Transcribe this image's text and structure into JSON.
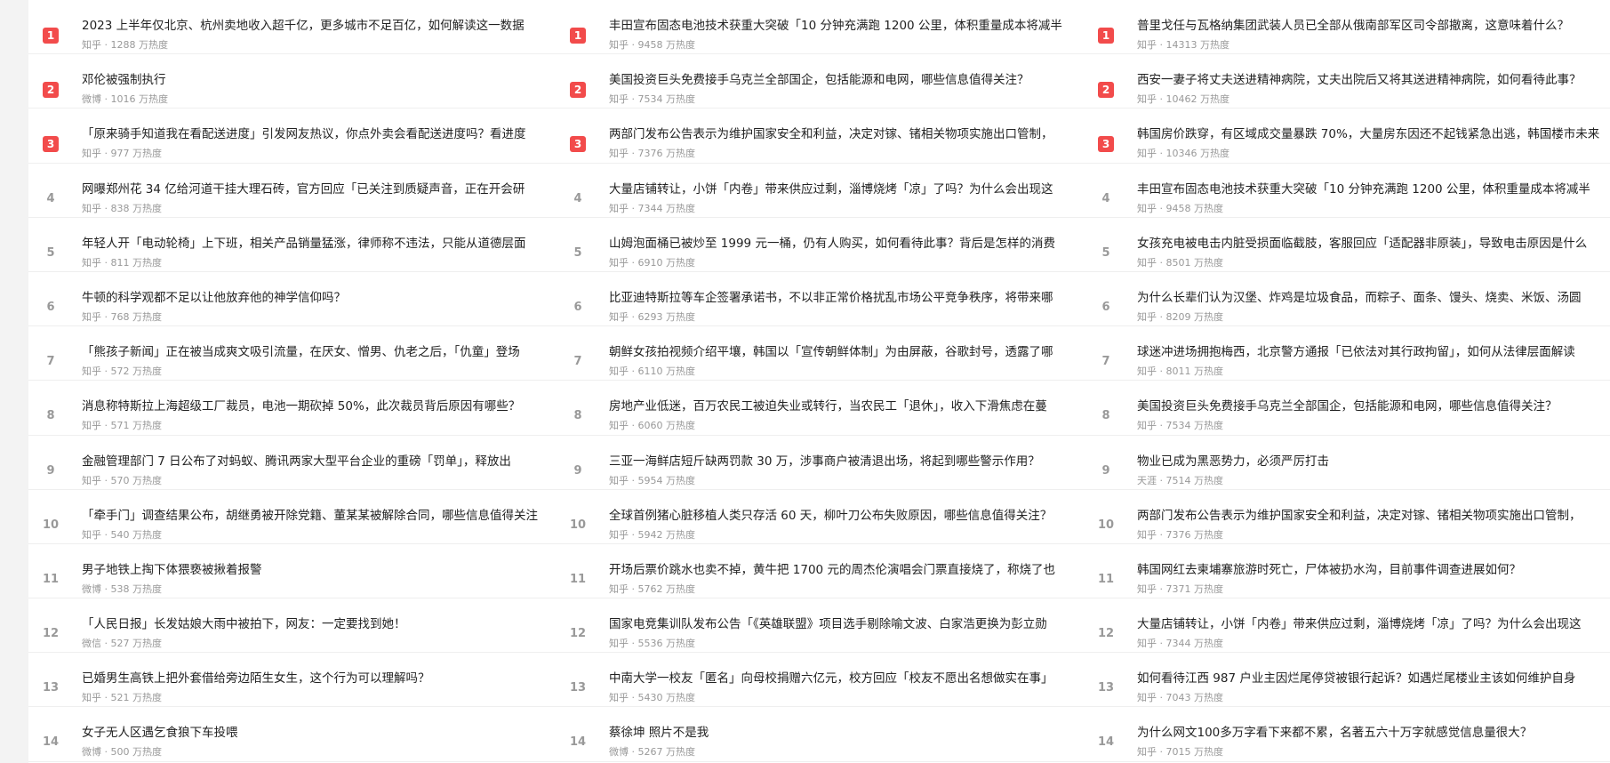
{
  "columns": [
    {
      "items": [
        {
          "rank": "1",
          "title": "2023 上半年仅北京、杭州卖地收入超千亿，更多城市不足百亿，如何解读这一数据",
          "meta": "知乎 · 1288 万热度"
        },
        {
          "rank": "2",
          "title": "邓伦被强制执行",
          "meta": "微博 · 1016 万热度"
        },
        {
          "rank": "3",
          "title": "「原来骑手知道我在看配送进度」引发网友热议，你点外卖会看配送进度吗？看进度",
          "meta": "知乎 · 977 万热度"
        },
        {
          "rank": "4",
          "title": "网曝郑州花 34 亿给河道干挂大理石砖，官方回应「已关注到质疑声音，正在开会研",
          "meta": "知乎 · 838 万热度"
        },
        {
          "rank": "5",
          "title": "年轻人开「电动轮椅」上下班，相关产品销量猛涨，律师称不违法，只能从道德层面",
          "meta": "知乎 · 811 万热度"
        },
        {
          "rank": "6",
          "title": "牛顿的科学观都不足以让他放弃他的神学信仰吗？",
          "meta": "知乎 · 768 万热度"
        },
        {
          "rank": "7",
          "title": "「熊孩子新闻」正在被当成爽文吸引流量，在厌女、憎男、仇老之后，「仇童」登场",
          "meta": "知乎 · 572 万热度"
        },
        {
          "rank": "8",
          "title": "消息称特斯拉上海超级工厂裁员，电池一期砍掉 50%，此次裁员背后原因有哪些？",
          "meta": "知乎 · 571 万热度"
        },
        {
          "rank": "9",
          "title": "金融管理部门 7 日公布了对蚂蚁、腾讯两家大型平台企业的重磅「罚单」，释放出",
          "meta": "知乎 · 570 万热度"
        },
        {
          "rank": "10",
          "title": "「牵手门」调查结果公布，胡继勇被开除党籍、董某某被解除合同，哪些信息值得关注",
          "meta": "知乎 · 540 万热度"
        },
        {
          "rank": "11",
          "title": "男子地铁上掏下体猥亵被揪着报警",
          "meta": "微博 · 538 万热度"
        },
        {
          "rank": "12",
          "title": "「人民日报」长发姑娘大雨中被拍下，网友：一定要找到她！",
          "meta": "微信 · 527 万热度"
        },
        {
          "rank": "13",
          "title": "已婚男生高铁上把外套借给旁边陌生女生，这个行为可以理解吗？",
          "meta": "知乎 · 521 万热度"
        },
        {
          "rank": "14",
          "title": "女子无人区遇乞食狼下车投喂",
          "meta": "微博 · 500 万热度"
        }
      ]
    },
    {
      "items": [
        {
          "rank": "1",
          "title": "丰田宣布固态电池技术获重大突破「10 分钟充满跑 1200 公里，体积重量成本将减半",
          "meta": "知乎 · 9458 万热度"
        },
        {
          "rank": "2",
          "title": "美国投资巨头免费接手乌克兰全部国企，包括能源和电网，哪些信息值得关注？",
          "meta": "知乎 · 7534 万热度"
        },
        {
          "rank": "3",
          "title": "两部门发布公告表示为维护国家安全和利益，决定对镓、锗相关物项实施出口管制，",
          "meta": "知乎 · 7376 万热度"
        },
        {
          "rank": "4",
          "title": "大量店铺转让，小饼「内卷」带来供应过剩，淄博烧烤「凉」了吗？为什么会出现这",
          "meta": "知乎 · 7344 万热度"
        },
        {
          "rank": "5",
          "title": "山姆泡面桶已被炒至 1999 元一桶，仍有人购买，如何看待此事？背后是怎样的消费",
          "meta": "知乎 · 6910 万热度"
        },
        {
          "rank": "6",
          "title": "比亚迪特斯拉等车企签署承诺书，不以非正常价格扰乱市场公平竞争秩序，将带来哪",
          "meta": "知乎 · 6293 万热度"
        },
        {
          "rank": "7",
          "title": "朝鲜女孩拍视频介绍平壤，韩国以「宣传朝鲜体制」为由屏蔽，谷歌封号，透露了哪",
          "meta": "知乎 · 6110 万热度"
        },
        {
          "rank": "8",
          "title": "房地产业低迷，百万农民工被迫失业或转行，当农民工「退休」，收入下滑焦虑在蔓",
          "meta": "知乎 · 6060 万热度"
        },
        {
          "rank": "9",
          "title": "三亚一海鲜店短斤缺两罚款 30 万，涉事商户被清退出场，将起到哪些警示作用？",
          "meta": "知乎 · 5954 万热度"
        },
        {
          "rank": "10",
          "title": "全球首例猪心脏移植人类只存活 60 天，柳叶刀公布失败原因，哪些信息值得关注？",
          "meta": "知乎 · 5942 万热度"
        },
        {
          "rank": "11",
          "title": "开场后票价跳水也卖不掉，黄牛把 1700 元的周杰伦演唱会门票直接烧了，称烧了也",
          "meta": "知乎 · 5762 万热度"
        },
        {
          "rank": "12",
          "title": "国家电竞集训队发布公告「《英雄联盟》项目选手剔除喻文波、白家浩更换为彭立勋",
          "meta": "知乎 · 5536 万热度"
        },
        {
          "rank": "13",
          "title": "中南大学一校友「匿名」向母校捐赠六亿元，校方回应「校友不愿出名想做实在事」",
          "meta": "知乎 · 5430 万热度"
        },
        {
          "rank": "14",
          "title": "蔡徐坤 照片不是我",
          "meta": "微博 · 5267 万热度"
        }
      ]
    },
    {
      "items": [
        {
          "rank": "1",
          "title": "普里戈任与瓦格纳集团武装人员已全部从俄南部军区司令部撤离，这意味着什么？",
          "meta": "知乎 · 14313 万热度"
        },
        {
          "rank": "2",
          "title": "西安一妻子将丈夫送进精神病院，丈夫出院后又将其送进精神病院，如何看待此事？",
          "meta": "知乎 · 10462 万热度"
        },
        {
          "rank": "3",
          "title": "韩国房价跌穿，有区域成交量暴跌 70%，大量房东因还不起钱紧急出逃，韩国楼市未来",
          "meta": "知乎 · 10346 万热度"
        },
        {
          "rank": "4",
          "title": "丰田宣布固态电池技术获重大突破「10 分钟充满跑 1200 公里，体积重量成本将减半",
          "meta": "知乎 · 9458 万热度"
        },
        {
          "rank": "5",
          "title": "女孩充电被电击内脏受损面临截肢，客服回应「适配器非原装」，导致电击原因是什么",
          "meta": "知乎 · 8501 万热度"
        },
        {
          "rank": "6",
          "title": "为什么长辈们认为汉堡、炸鸡是垃圾食品，而粽子、面条、馒头、烧卖、米饭、汤圆",
          "meta": "知乎 · 8209 万热度"
        },
        {
          "rank": "7",
          "title": "球迷冲进场拥抱梅西，北京警方通报「已依法对其行政拘留」，如何从法律层面解读",
          "meta": "知乎 · 8011 万热度"
        },
        {
          "rank": "8",
          "title": "美国投资巨头免费接手乌克兰全部国企，包括能源和电网，哪些信息值得关注？",
          "meta": "知乎 · 7534 万热度"
        },
        {
          "rank": "9",
          "title": "物业已成为黑恶势力，必须严厉打击",
          "meta": "天涯 · 7514 万热度"
        },
        {
          "rank": "10",
          "title": "两部门发布公告表示为维护国家安全和利益，决定对镓、锗相关物项实施出口管制，",
          "meta": "知乎 · 7376 万热度"
        },
        {
          "rank": "11",
          "title": "韩国网红去柬埔寨旅游时死亡，尸体被扔水沟，目前事件调查进展如何？",
          "meta": "知乎 · 7371 万热度"
        },
        {
          "rank": "12",
          "title": "大量店铺转让，小饼「内卷」带来供应过剩，淄博烧烤「凉」了吗？为什么会出现这",
          "meta": "知乎 · 7344 万热度"
        },
        {
          "rank": "13",
          "title": "如何看待江西 987 户业主因烂尾停贷被银行起诉？如遇烂尾楼业主该如何维护自身",
          "meta": "知乎 · 7043 万热度"
        },
        {
          "rank": "14",
          "title": "为什么网文100多万字看下来都不累，名著五六十万字就感觉信息量很大？",
          "meta": "知乎 · 7015 万热度"
        }
      ]
    }
  ],
  "colors": {
    "top_rank_bg": "#f24b4b",
    "rank_text": "#999999",
    "title_text": "#222222",
    "meta_text": "#999999"
  }
}
